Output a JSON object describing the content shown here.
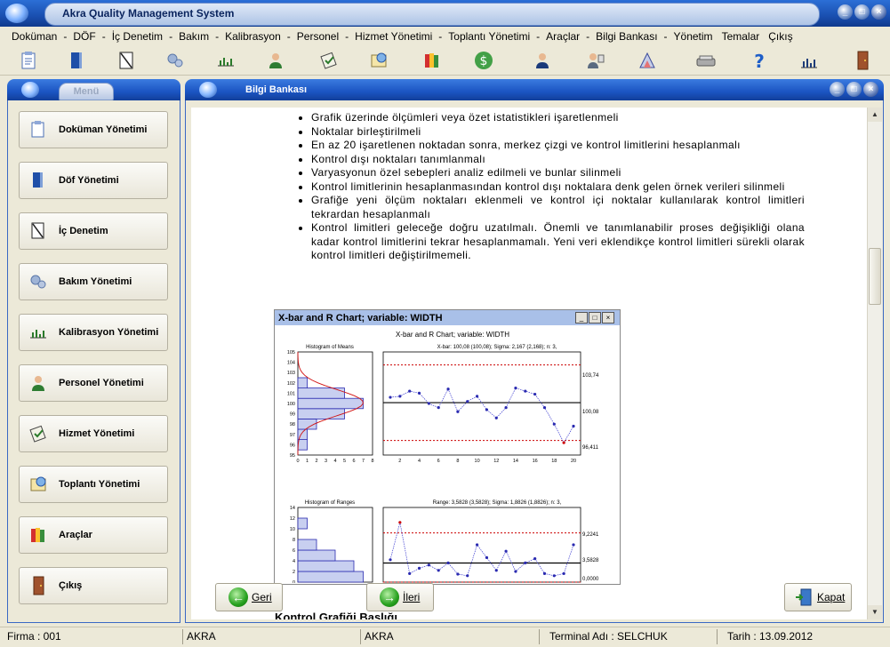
{
  "app": {
    "title": "Akra Quality Management System"
  },
  "menu": [
    "Doküman",
    "DÖF",
    "İç Denetim",
    "Bakım",
    "Kalibrasyon",
    "Personel",
    "Hizmet Yönetimi",
    "Toplantı Yönetimi",
    "Araçlar",
    "Bilgi Bankası",
    "Yönetim",
    "Temalar",
    "Çıkış"
  ],
  "toolbar_icons": [
    "clipboard-icon",
    "book-icon",
    "audit-icon",
    "gears-icon",
    "calibration-icon",
    "person-icon",
    "service-icon",
    "meeting-icon",
    "tools-icon",
    "dollar-icon",
    "manager-icon",
    "presenter-icon",
    "chart-icon",
    "scanner-icon",
    "help-icon",
    "stats-icon",
    "door-icon"
  ],
  "left_panel": {
    "tab": "Menü",
    "items": [
      {
        "label": "Doküman Yönetimi",
        "icon": "clipboard-icon"
      },
      {
        "label": "Döf Yönetimi",
        "icon": "book-icon"
      },
      {
        "label": "İç Denetim",
        "icon": "audit-icon"
      },
      {
        "label": "Bakım Yönetimi",
        "icon": "gears-icon"
      },
      {
        "label": "Kalibrasyon Yönetimi",
        "icon": "calibration-icon"
      },
      {
        "label": "Personel Yönetimi",
        "icon": "person-icon"
      },
      {
        "label": "Hizmet Yönetimi",
        "icon": "service-icon"
      },
      {
        "label": "Toplantı Yönetimi",
        "icon": "meeting-icon"
      },
      {
        "label": "Araçlar",
        "icon": "tools-icon"
      },
      {
        "label": "Çıkış",
        "icon": "door-icon"
      }
    ]
  },
  "content": {
    "title": "Bilgi Bankası",
    "bullets": [
      "Grafik üzerinde ölçümleri veya özet istatistikleri işaretlenmeli",
      "Noktalar birleştirilmeli",
      "En az 20 işaretlenen noktadan sonra, merkez çizgi ve kontrol limitlerini hesaplanmalı",
      "Kontrol dışı noktaları tanımlanmalı",
      "Varyasyonun özel sebepleri analiz edilmeli ve bunlar silinmeli",
      "Kontrol limitlerinin hesaplanmasından kontrol dışı noktalara denk gelen örnek verileri silinmeli",
      "Grafiğe yeni ölçüm noktaları eklenmeli ve kontrol içi noktalar kullanılarak kontrol limitleri tekrardan hesaplanmalı",
      "Kontrol limitleri geleceğe doğru uzatılmalı. Önemli ve tanımlanabilir proses değişikliği olana kadar kontrol limitlerini tekrar hesaplanmamalı. Yeni veri eklendikçe kontrol limitleri sürekli olarak kontrol limitleri değiştirilmemeli."
    ],
    "caption": "Kontrol Grafiği Başlığı",
    "chart_window": {
      "title": "X-bar and R Chart; variable: WIDTH",
      "heading": "X-bar and R Chart; variable: WIDTH",
      "hist1_title": "Histogram of Means",
      "xbar_title": "X-bar: 100,08 (100,08); Sigma: 2,167 (2,168); n: 3,",
      "hist2_title": "Histogram of Ranges",
      "r_title": "Range: 3,5828 (3,5828); Sigma: 1,8826 (1,8826); n: 3,",
      "xbar_labels": {
        "ucl": "103,74",
        "center": "100,08",
        "lcl": "96,411"
      },
      "r_labels": {
        "ucl": "9,2241",
        "center": "3,5828",
        "lcl": "0,0000"
      }
    },
    "buttons": {
      "back": "Geri",
      "next": "İleri",
      "close": "Kapat"
    }
  },
  "status": {
    "firma": "Firma : 001",
    "f1": "AKRA",
    "f2": "AKRA",
    "terminal": "Terminal Adı : SELCHUK",
    "tarih": "Tarih : 13.09.2012"
  },
  "chart_data": [
    {
      "type": "line",
      "title": "X-bar: 100,08 (100,08); Sigma: 2,167 (2,168); n: 3,",
      "xlabel": "",
      "ylabel": "",
      "x": [
        1,
        2,
        3,
        4,
        5,
        6,
        7,
        8,
        9,
        10,
        11,
        12,
        13,
        14,
        15,
        16,
        17,
        18,
        19,
        20
      ],
      "series": [
        {
          "values": [
            100.6,
            100.7,
            101.2,
            101.0,
            100.0,
            99.6,
            101.4,
            99.2,
            100.2,
            100.7,
            99.4,
            98.6,
            99.6,
            101.5,
            101.2,
            100.9,
            99.6,
            98.0,
            96.2,
            97.8
          ]
        }
      ],
      "reference_lines": {
        "ucl": 103.74,
        "center": 100.08,
        "lcl": 96.411
      },
      "ylim": [
        95,
        105
      ],
      "xticks": [
        2,
        4,
        6,
        8,
        10,
        12,
        14,
        16,
        18,
        20
      ]
    },
    {
      "type": "line",
      "title": "Range: 3,5828 (3,5828); Sigma: 1,8826 (1,8826); n: 3,",
      "xlabel": "",
      "ylabel": "",
      "x": [
        1,
        2,
        3,
        4,
        5,
        6,
        7,
        8,
        9,
        10,
        11,
        12,
        13,
        14,
        15,
        16,
        17,
        18,
        19,
        20
      ],
      "series": [
        {
          "values": [
            4.2,
            11.2,
            1.6,
            2.6,
            3.2,
            2.2,
            3.6,
            1.5,
            1.2,
            7.0,
            4.6,
            2.2,
            5.8,
            2.0,
            3.6,
            4.4,
            1.6,
            1.2,
            1.6,
            7.0
          ]
        }
      ],
      "reference_lines": {
        "ucl": 9.2241,
        "center": 3.5828,
        "lcl": 0.0
      },
      "ylim": [
        0,
        14
      ]
    },
    {
      "type": "bar",
      "title": "Histogram of Means",
      "categories": [
        "96",
        "97",
        "98",
        "99",
        "100",
        "101",
        "102",
        "103"
      ],
      "values": [
        1,
        1,
        2,
        5,
        7,
        5,
        1,
        0
      ],
      "xticks": [
        0,
        1,
        2,
        3,
        4,
        5,
        6,
        7,
        8
      ],
      "yticks": [
        95,
        96,
        97,
        98,
        99,
        100,
        101,
        102,
        103,
        104,
        105
      ]
    },
    {
      "type": "bar",
      "title": "Histogram of Ranges",
      "categories": [
        "0-2",
        "2-4",
        "4-6",
        "6-8",
        "8-10",
        "10-12"
      ],
      "values": [
        7,
        6,
        4,
        2,
        0,
        1
      ],
      "yticks": [
        0,
        2,
        4,
        6,
        8,
        10,
        12,
        14
      ]
    }
  ]
}
